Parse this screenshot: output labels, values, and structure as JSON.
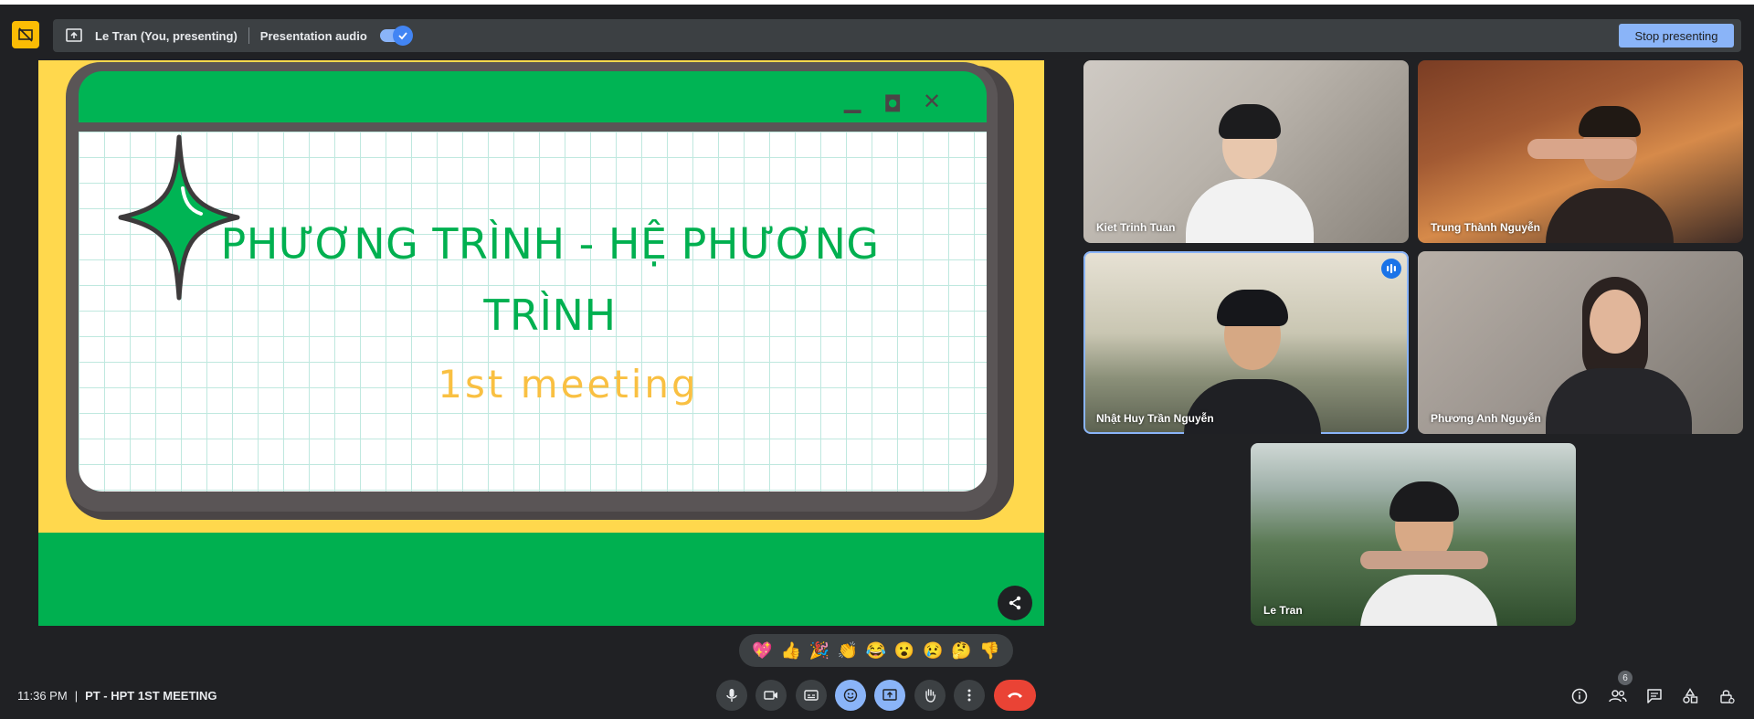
{
  "presenting_bar": {
    "presenter": "Le Tran (You, presenting)",
    "audio_label": "Presentation audio",
    "audio_on": true,
    "stop_label": "Stop presenting"
  },
  "slide": {
    "title_line1": "PHƯƠNG TRÌNH - HỆ PHƯƠNG",
    "title_line2": "TRÌNH",
    "subtitle": "1st meeting",
    "colors": {
      "yellow": "#ffd84d",
      "green": "#00b050",
      "subtitle": "#f9c042"
    }
  },
  "participants": [
    {
      "name": "Kiet Trinh Tuan",
      "speaking": false
    },
    {
      "name": "Trung Thành Nguyễn",
      "speaking": false
    },
    {
      "name": "Nhật Huy Trần Nguyễn",
      "speaking": true
    },
    {
      "name": "Phương Anh Nguyễn",
      "speaking": false
    },
    {
      "name": "Le Tran",
      "speaking": false
    }
  ],
  "reactions": [
    "💖",
    "👍",
    "🎉",
    "👏",
    "😂",
    "😮",
    "😢",
    "🤔",
    "👎"
  ],
  "meeting": {
    "time": "11:36 PM",
    "separator": "|",
    "code": "PT - HPT 1ST MEETING",
    "participant_count": "6"
  },
  "icons": [
    "presentation-off-icon",
    "present-screen-icon",
    "share-icon",
    "mic-icon",
    "camera-icon",
    "captions-icon",
    "emoji-icon",
    "present-icon",
    "raise-hand-icon",
    "more-options-icon",
    "end-call-icon",
    "info-icon",
    "people-icon",
    "chat-icon",
    "activities-icon",
    "host-controls-icon"
  ]
}
